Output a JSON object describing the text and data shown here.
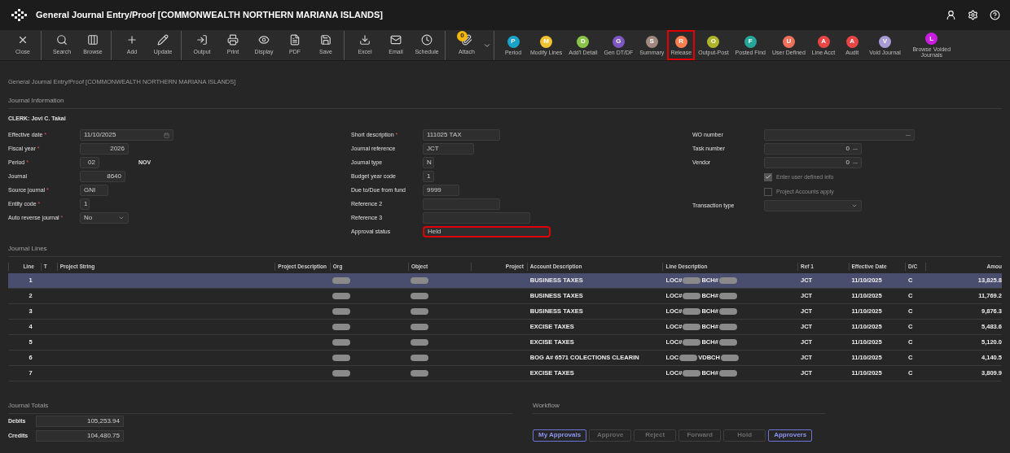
{
  "window": {
    "title": "General Journal Entry/Proof [COMMONWEALTH NORTHERN MARIANA ISLANDS]"
  },
  "toolbar": [
    [
      {
        "kind": "icon",
        "label": "Close"
      }
    ],
    [
      {
        "kind": "icon",
        "label": "Search"
      },
      {
        "kind": "icon",
        "label": "Browse"
      }
    ],
    [
      {
        "kind": "icon",
        "label": "Add"
      },
      {
        "kind": "icon",
        "label": "Update"
      }
    ],
    [
      {
        "kind": "icon",
        "label": "Output"
      },
      {
        "kind": "icon",
        "label": "Print"
      },
      {
        "kind": "icon",
        "label": "Display"
      },
      {
        "kind": "icon",
        "label": "PDF"
      },
      {
        "kind": "icon",
        "label": "Save"
      }
    ],
    [
      {
        "kind": "icon",
        "label": "Excel"
      },
      {
        "kind": "icon",
        "label": "Email"
      },
      {
        "kind": "icon",
        "label": "Schedule"
      }
    ],
    [
      {
        "kind": "attach",
        "label": "Attach",
        "badge": "0"
      }
    ],
    [
      {
        "kind": "letter",
        "letter": "P",
        "label": "Period",
        "color": "#1aa3c9",
        "highlighted": false
      },
      {
        "kind": "letter",
        "letter": "M",
        "label": "Modify Lines",
        "color": "#f2c230",
        "highlighted": false
      },
      {
        "kind": "letter",
        "letter": "D",
        "label": "Add'l Detail",
        "color": "#8bc34a",
        "highlighted": false
      },
      {
        "kind": "letter",
        "letter": "G",
        "label": "Gen DT/DF",
        "color": "#7e57c2",
        "highlighted": false
      },
      {
        "kind": "letter",
        "letter": "S",
        "label": "Summary",
        "color": "#a1887f",
        "highlighted": false
      },
      {
        "kind": "letter",
        "letter": "R",
        "label": "Release",
        "color": "#ff7f50",
        "highlighted": true
      },
      {
        "kind": "letter",
        "letter": "O",
        "label": "Output-Post",
        "color": "#afb42b",
        "highlighted": false
      },
      {
        "kind": "letter",
        "letter": "F",
        "label": "Posted Find",
        "color": "#26a69a",
        "highlighted": false
      },
      {
        "kind": "letter",
        "letter": "U",
        "label": "User Defined",
        "color": "#f0705a",
        "highlighted": false
      },
      {
        "kind": "letter",
        "letter": "A",
        "label": "Line Acct",
        "color": "#e84545",
        "highlighted": false
      },
      {
        "kind": "letter",
        "letter": "A",
        "label": "Audit",
        "color": "#e84545",
        "highlighted": false
      },
      {
        "kind": "letter",
        "letter": "V",
        "label": "Void Journal",
        "color": "#a99bd6",
        "highlighted": false
      },
      {
        "kind": "letter",
        "letter": "L",
        "label": "Browse Voided Journals",
        "color": "#c81ee0",
        "highlighted": false
      }
    ]
  ],
  "breadcrumb": "General Journal Entry/Proof [COMMONWEALTH NORTHERN MARIANA ISLANDS]",
  "journal_information": {
    "title": "Journal Information",
    "clerk": "CLERK: Jovi C. Takai",
    "columns": [
      [
        {
          "label": "Effective date",
          "required_mark": "*",
          "kind": "date",
          "value": "11/10/2025"
        },
        {
          "label": "Fiscal year",
          "required_mark": "*",
          "kind": "number",
          "value": "2026"
        },
        {
          "label": "Period",
          "required_mark": "*",
          "kind": "number",
          "value": "02",
          "note": "NOV"
        },
        {
          "label": "Journal",
          "kind": "number",
          "value": "8640"
        },
        {
          "label": "Source journal",
          "required_mark": "*",
          "kind": "text",
          "value": "GNI"
        },
        {
          "label": "Entity code",
          "required_mark": "*",
          "kind": "text",
          "value": "1"
        },
        {
          "label": "Auto reverse journal",
          "required_mark": "*",
          "kind": "select",
          "value": "No"
        }
      ],
      [
        {
          "label": "Short description",
          "required_mark": "*",
          "kind": "text",
          "value": "111025 TAX"
        },
        {
          "label": "Journal reference",
          "kind": "text",
          "value": "JCT"
        },
        {
          "label": "Journal type",
          "kind": "text",
          "value": "N"
        },
        {
          "label": "Budget year code",
          "kind": "text",
          "value": "1"
        },
        {
          "label": "Due to/Due from fund",
          "kind": "text",
          "value": "9999"
        },
        {
          "label": "Reference 2",
          "kind": "text"
        },
        {
          "label": "Reference 3",
          "kind": "text"
        },
        {
          "label": "Approval status",
          "kind": "text",
          "value": "Held",
          "highlighted": true
        }
      ],
      [
        {
          "label": "WO number",
          "kind": "lookup"
        },
        {
          "label": "Task number",
          "kind": "lookup",
          "value": "0"
        },
        {
          "label": "Vendor",
          "kind": "lookup",
          "value": "0"
        },
        {
          "label": "Enter user defined info",
          "kind": "checkbox",
          "checked": true
        },
        {
          "label": "Project Accounts apply",
          "kind": "checkbox",
          "checked": false
        },
        {
          "label": "Transaction type",
          "kind": "select"
        }
      ]
    ]
  },
  "journal_lines": {
    "title": "Journal Lines",
    "columns": [
      "Line",
      "T",
      "Project String",
      "Project Description",
      "Org",
      "Object",
      "Project",
      "Account Description",
      "Line Description",
      "Ref 1",
      "Effective Date",
      "D/C",
      "Amou"
    ],
    "rows": [
      {
        "line": "1",
        "selected": true,
        "redacted": true,
        "account_description": "BUSINESS TAXES",
        "line_description": [
          "LOC#",
          "BCH#"
        ],
        "ref1": "JCT",
        "effective_date": "11/10/2025",
        "dc": "C",
        "amount": "13,825.8"
      },
      {
        "line": "2",
        "selected": false,
        "redacted": true,
        "account_description": "BUSINESS TAXES",
        "line_description": [
          "LOC#",
          "BCH#"
        ],
        "ref1": "JCT",
        "effective_date": "11/10/2025",
        "dc": "C",
        "amount": "11,769.2"
      },
      {
        "line": "3",
        "selected": false,
        "redacted": true,
        "account_description": "BUSINESS TAXES",
        "line_description": [
          "LOC#",
          "BCH#"
        ],
        "ref1": "JCT",
        "effective_date": "11/10/2025",
        "dc": "C",
        "amount": "9,876.3"
      },
      {
        "line": "4",
        "selected": false,
        "redacted": true,
        "account_description": "EXCISE TAXES",
        "line_description": [
          "LOC#",
          "BCH#"
        ],
        "ref1": "JCT",
        "effective_date": "11/10/2025",
        "dc": "C",
        "amount": "5,483.6"
      },
      {
        "line": "5",
        "selected": false,
        "redacted": true,
        "account_description": "EXCISE TAXES",
        "line_description": [
          "LOC#",
          "BCH#"
        ],
        "ref1": "JCT",
        "effective_date": "11/10/2025",
        "dc": "C",
        "amount": "5,120.0"
      },
      {
        "line": "6",
        "selected": false,
        "redacted": true,
        "account_description": "BOG A# 6571 COLECTIONS CLEARIN",
        "line_description": [
          "LOC",
          "VDBCH"
        ],
        "ref1": "JCT",
        "effective_date": "11/10/2025",
        "dc": "C",
        "amount": "4,140.5"
      },
      {
        "line": "7",
        "selected": false,
        "redacted": true,
        "account_description": "EXCISE TAXES",
        "line_description": [
          "LOC#",
          "BCH#"
        ],
        "ref1": "JCT",
        "effective_date": "11/10/2025",
        "dc": "C",
        "amount": "3,809.9"
      }
    ]
  },
  "journal_totals": {
    "title": "Journal Totals",
    "items": [
      {
        "label": "Debits",
        "value": "105,253.94"
      },
      {
        "label": "Credits",
        "value": "104,480.75"
      }
    ]
  },
  "workflow": {
    "title": "Workflow",
    "buttons": [
      {
        "label": "My Approvals",
        "enabled": true
      },
      {
        "label": "Approve",
        "enabled": false
      },
      {
        "label": "Reject",
        "enabled": false
      },
      {
        "label": "Forward",
        "enabled": false
      },
      {
        "label": "Hold",
        "enabled": false
      },
      {
        "label": "Approvers",
        "enabled": true
      }
    ]
  }
}
